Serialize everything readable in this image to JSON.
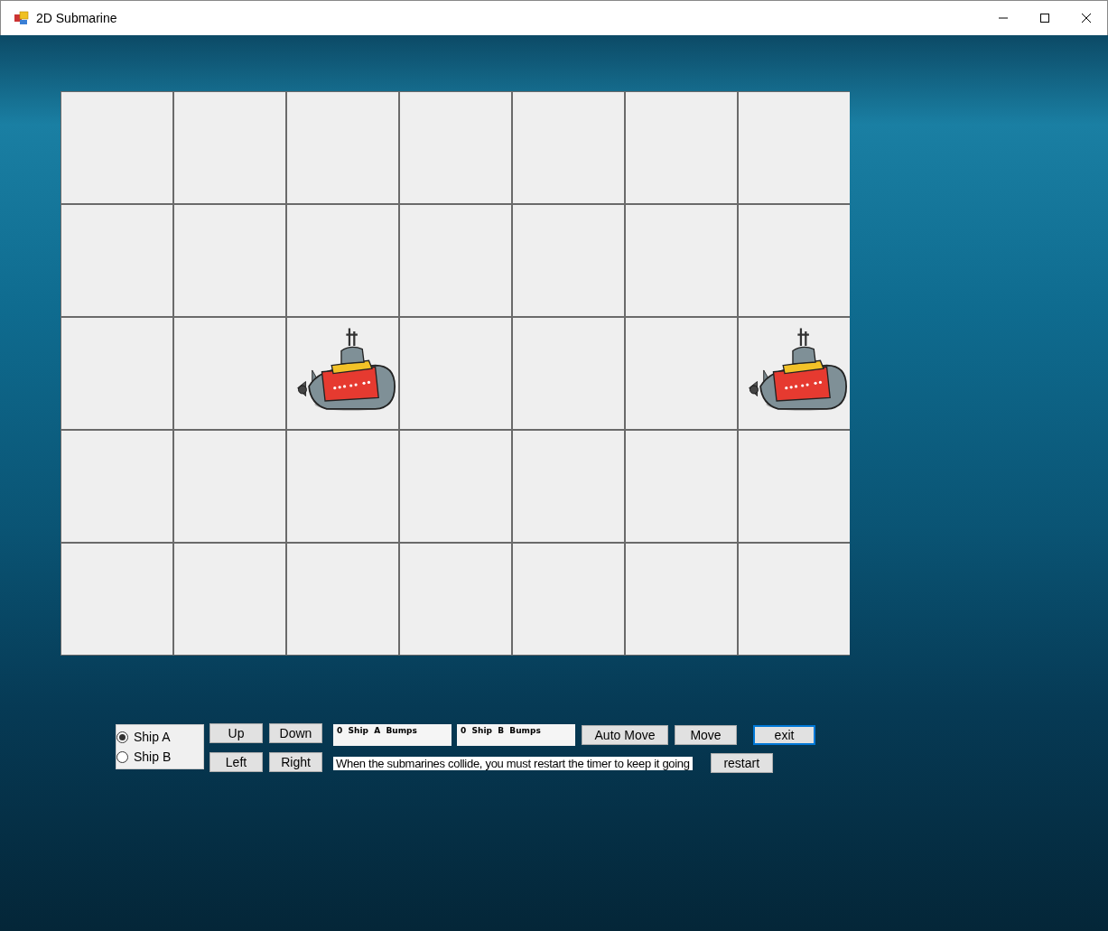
{
  "window": {
    "title": "2D Submarine"
  },
  "grid": [
    {
      "cells": [
        {
          "submarine": false
        },
        {
          "submarine": false
        },
        {
          "submarine": false
        },
        {
          "submarine": false
        },
        {
          "submarine": false
        },
        {
          "submarine": false
        },
        {
          "submarine": false
        }
      ]
    },
    {
      "cells": [
        {
          "submarine": false
        },
        {
          "submarine": false
        },
        {
          "submarine": false
        },
        {
          "submarine": false
        },
        {
          "submarine": false
        },
        {
          "submarine": false
        },
        {
          "submarine": false
        }
      ]
    },
    {
      "cells": [
        {
          "submarine": false
        },
        {
          "submarine": false
        },
        {
          "submarine": true
        },
        {
          "submarine": false
        },
        {
          "submarine": false
        },
        {
          "submarine": false
        },
        {
          "submarine": true
        }
      ]
    },
    {
      "cells": [
        {
          "submarine": false
        },
        {
          "submarine": false
        },
        {
          "submarine": false
        },
        {
          "submarine": false
        },
        {
          "submarine": false
        },
        {
          "submarine": false
        },
        {
          "submarine": false
        }
      ]
    },
    {
      "cells": [
        {
          "submarine": false
        },
        {
          "submarine": false
        },
        {
          "submarine": false
        },
        {
          "submarine": false
        },
        {
          "submarine": false
        },
        {
          "submarine": false
        },
        {
          "submarine": false
        }
      ]
    }
  ],
  "ships": [
    {
      "label": "Ship A",
      "selected": true
    },
    {
      "label": "Ship B",
      "selected": false
    }
  ],
  "direction_buttons": [
    "Up",
    "Down",
    "Left",
    "Right"
  ],
  "bump_counters": [
    "0  Ship  A  Bumps",
    "0  Ship  B  Bumps"
  ],
  "buttons": [
    {
      "label": "Auto Move",
      "focused": false
    },
    {
      "label": "Move",
      "focused": false
    },
    {
      "label": "exit",
      "focused": true
    }
  ],
  "message": "When the submarines collide, you must restart the timer to keep it going",
  "restart_button": "restart"
}
